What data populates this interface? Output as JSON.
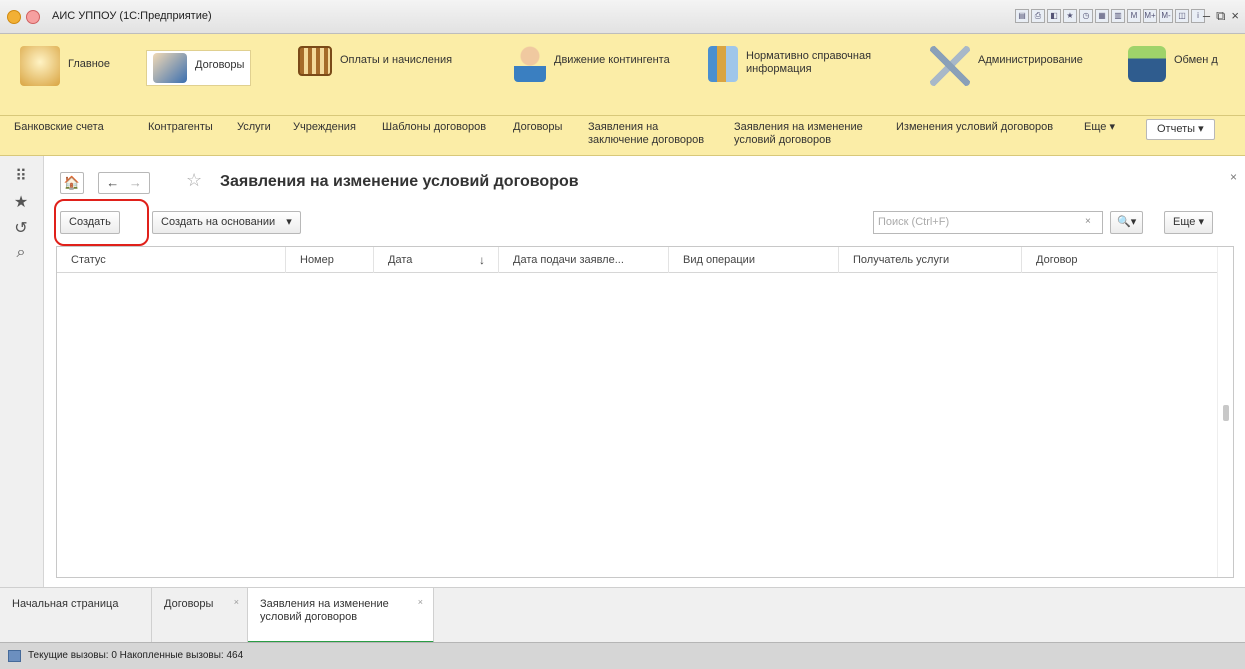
{
  "window": {
    "title": "АИС УППОУ (1С:Предприятие)",
    "tool_icons": [
      "save-icon",
      "print-icon",
      "preview-icon",
      "favorites-icon",
      "history-icon",
      "calendar-icon",
      "calc-icon",
      "M",
      "M+",
      "M-",
      "panels-icon",
      "info-icon"
    ],
    "controls": [
      "–",
      "⧉",
      "×"
    ]
  },
  "sections": [
    {
      "label": "Главное",
      "icon": "home-desk-icon",
      "color": "#d9a441"
    },
    {
      "label": "Договоры",
      "icon": "contract-hand-icon",
      "color": "#3b6fb0"
    },
    {
      "label": "Оплаты и начисления",
      "icon": "abacus-icon",
      "color": "#a56b2a"
    },
    {
      "label": "Движение контингента",
      "icon": "person-icon",
      "color": "#3a7fc1"
    },
    {
      "label": "Нормативно справочная информация",
      "icon": "books-icon",
      "color": "#4a8fd0"
    },
    {
      "label": "Администрирование",
      "icon": "tools-icon",
      "color": "#8aa0b8"
    },
    {
      "label": "Обмен д",
      "icon": "disk-exchange-icon",
      "color": "#2f5c8e"
    }
  ],
  "commands": {
    "items": [
      "Банковские счета",
      "Контрагенты",
      "Услуги",
      "Учреждения",
      "Шаблоны договоров",
      "Договоры",
      "Заявления на заключение договоров",
      "Заявления на изменение условий договоров",
      "Изменения условий договоров"
    ],
    "more": "Еще ▾",
    "reports": "Отчеты ▾"
  },
  "form": {
    "title": "Заявления на изменение условий договоров",
    "home_glyph": "🏠",
    "back_glyph": "←",
    "forward_glyph": "→",
    "star_glyph": "☆",
    "close_glyph": "×",
    "create_button": "Создать",
    "create_based_button": "Создать на основании",
    "dropdown_glyph": "▾",
    "search_placeholder": "Поиск (Ctrl+F)",
    "search_clear": "×",
    "search_glyph": "🔍▾",
    "more_button": "Еще ▾"
  },
  "table": {
    "columns": [
      "Статус",
      "Номер",
      "Дата",
      "Дата подачи заявле...",
      "Вид операции",
      "Получатель услуги",
      "Договор"
    ],
    "sort_glyph": "↓",
    "rows": []
  },
  "open_windows": [
    {
      "label": "Начальная страница",
      "closable": false,
      "active": false
    },
    {
      "label": "Договоры",
      "closable": true,
      "active": false
    },
    {
      "label": "Заявления на изменение условий договоров",
      "closable": true,
      "active": true
    }
  ],
  "status": {
    "text": "Текущие вызовы: 0   Накопленные вызовы: 464"
  }
}
